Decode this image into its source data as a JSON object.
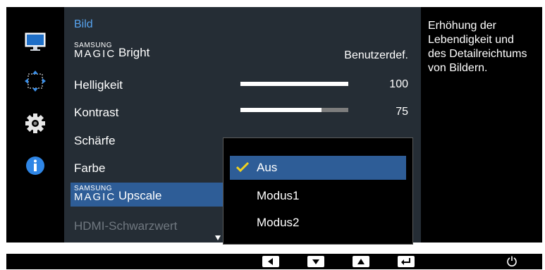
{
  "menu": {
    "title": "Bild",
    "items": [
      {
        "brand_small": "SAMSUNG",
        "brand_big": "MAGIC",
        "label": "Bright",
        "value": "Benutzerdef."
      },
      {
        "label": "Helligkeit",
        "value": "100",
        "level": 1.0
      },
      {
        "label": "Kontrast",
        "value": "75",
        "level": 0.75
      },
      {
        "label": "Schärfe"
      },
      {
        "label": "Farbe"
      },
      {
        "brand_small": "SAMSUNG",
        "brand_big": "MAGIC",
        "label": "Upscale",
        "highlighted": true
      },
      {
        "label": "HDMI-Schwarzwert",
        "disabled": true
      }
    ]
  },
  "dropdown": {
    "options": [
      {
        "label": "Aus",
        "selected": true
      },
      {
        "label": "Modus1",
        "selected": false
      },
      {
        "label": "Modus2",
        "selected": false
      }
    ]
  },
  "description": "Erhöhung der Lebendigkeit und des Detailreichtums von Bildern.",
  "sidebar_icons": [
    "monitor-icon",
    "position-arrows-icon",
    "settings-gear-icon",
    "info-icon"
  ],
  "button_bar_icons": [
    "left-arrow-icon",
    "down-arrow-icon",
    "up-arrow-icon",
    "enter-icon",
    "power-icon"
  ],
  "colors": {
    "title": "#57a3ee",
    "highlight": "#2e5d97",
    "panel": "#252d35",
    "check": "#f1d21f"
  }
}
